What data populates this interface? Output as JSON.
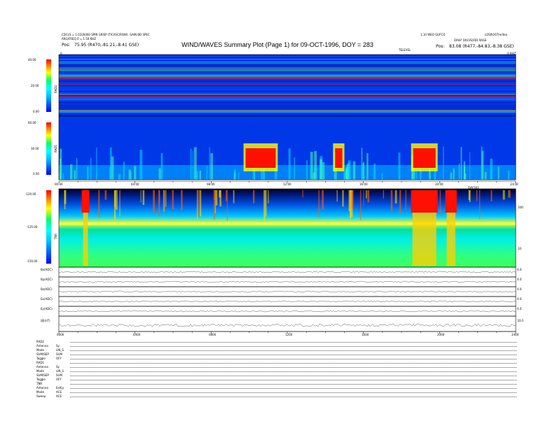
{
  "header": {
    "title": "WIND/WAVES Summary Plot (Page 1) for 09-OCT-1996, DOY = 283",
    "left_line1": "CDCLS = 1.0226000 SPIN GRISP (TIC/ISC/ROW). GAIN BD SPEC",
    "left_line2": "ARG/FREQ 0 = 1.50 KHZ",
    "left_pos_label": "Pos:",
    "left_pos_value": "75.95 (R470,-81.21,-8.41 GSE)",
    "right_line1": "1.10 WEO GUFCO",
    "right_line2": "LOSROO7m/dan",
    "right_line3": "DAILY 1Kt/3S(0D) RAGE",
    "right_pos_label": "Pos:",
    "right_pos_value": "83.08 (R477,-84.83,-8.38 GSE)",
    "timeline_label": "TELEVEL",
    "corner_left": "0",
    "corner_right": "0 KHZ"
  },
  "panels": {
    "rad2": {
      "name": "RAD2",
      "ticks": [
        "40.00",
        "20.00",
        "0.00"
      ]
    },
    "rad1": {
      "name": "RAD1",
      "ticks": [
        "60.00",
        "30.00",
        "0.00"
      ]
    },
    "tnr": {
      "name": "TNR",
      "ticks": [
        "-120.00",
        "-135.00",
        "-150.00"
      ],
      "right_ticks": [
        "100",
        "10"
      ]
    }
  },
  "time_axis_top": [
    "00:00",
    "04:00",
    "08:00",
    "12:00",
    "16:00",
    "20:00",
    "24:00"
  ],
  "time_axis_bottom": [
    "0000",
    "0400",
    "0800",
    "1200",
    "1600",
    "2000",
    "2400"
  ],
  "time_axis_mid_label": "DAY283",
  "traces": [
    {
      "label": "Bx(ADC)",
      "right": "0.0"
    },
    {
      "label": "By(ADC)",
      "right": "0.0"
    },
    {
      "label": "Bz(ADC)",
      "right": "0.0"
    },
    {
      "label": "Ex(ADC)",
      "right": "0.0"
    },
    {
      "label": "Ey(ADC)",
      "right": "0.0"
    },
    {
      "label": "|B|(nT)",
      "right": "10.0"
    }
  ],
  "footer_rows": [
    {
      "a": "RAD2",
      "b": ""
    },
    {
      "a": "Antenna",
      "b": "Sy"
    },
    {
      "a": "Mode",
      "b": "LIN_S"
    },
    {
      "a": "SUM/SEP",
      "b": "SUM"
    },
    {
      "a": "Toggle",
      "b": "OFF"
    },
    {
      "a": "RAD1",
      "b": ""
    },
    {
      "a": "Antenna",
      "b": "Sy"
    },
    {
      "a": "Mode",
      "b": "LIN_S"
    },
    {
      "a": "SUM/SEP",
      "b": "SUM"
    },
    {
      "a": "Toggle",
      "b": "OFF"
    },
    {
      "a": "TNR",
      "b": ""
    },
    {
      "a": "Antenna",
      "b": "Ex/Ey"
    },
    {
      "a": "Mode",
      "b": "ACE"
    },
    {
      "a": "Sweep",
      "b": "ACE"
    }
  ],
  "colorbar_colors": [
    "#000000",
    "#0000ff",
    "#00bfff",
    "#00ffff",
    "#00ff66",
    "#ffff00",
    "#ff8000",
    "#ff0000"
  ],
  "chart_data": {
    "type": "heatmap",
    "title": "WIND/WAVES Summary Plot (Page 1) for 09-OCT-1996, DOY = 283",
    "x": {
      "label": "",
      "range": [
        "00:00",
        "24:00"
      ],
      "ticks": [
        "00:00",
        "04:00",
        "08:00",
        "12:00",
        "16:00",
        "20:00",
        "24:00"
      ]
    },
    "panels": [
      {
        "name": "RAD2",
        "y_ticks": [
          40.0,
          20.0,
          0.0
        ],
        "ylim": [
          0.0,
          40.0
        ]
      },
      {
        "name": "RAD1",
        "y_ticks": [
          60.0,
          30.0,
          0.0
        ],
        "ylim": [
          0.0,
          60.0
        ]
      },
      {
        "name": "TNR",
        "y_ticks": [
          -120.0,
          -135.0,
          -150.0
        ],
        "ylim": [
          -150.0,
          -120.0
        ],
        "right_ticks": [
          100,
          10
        ]
      }
    ],
    "events_hours": [
      {
        "start": 18.5,
        "end": 19.9,
        "note": "intense red burst RAD1/TNR"
      },
      {
        "start": 9.7,
        "end": 11.5,
        "note": "enhanced activity RAD1"
      },
      {
        "start": 14.4,
        "end": 15.0,
        "note": "enhanced activity RAD1"
      },
      {
        "start": 1.2,
        "end": 1.6,
        "note": "TNR burst"
      },
      {
        "start": 20.3,
        "end": 20.9,
        "note": "TNR burst"
      }
    ],
    "grid": false
  }
}
